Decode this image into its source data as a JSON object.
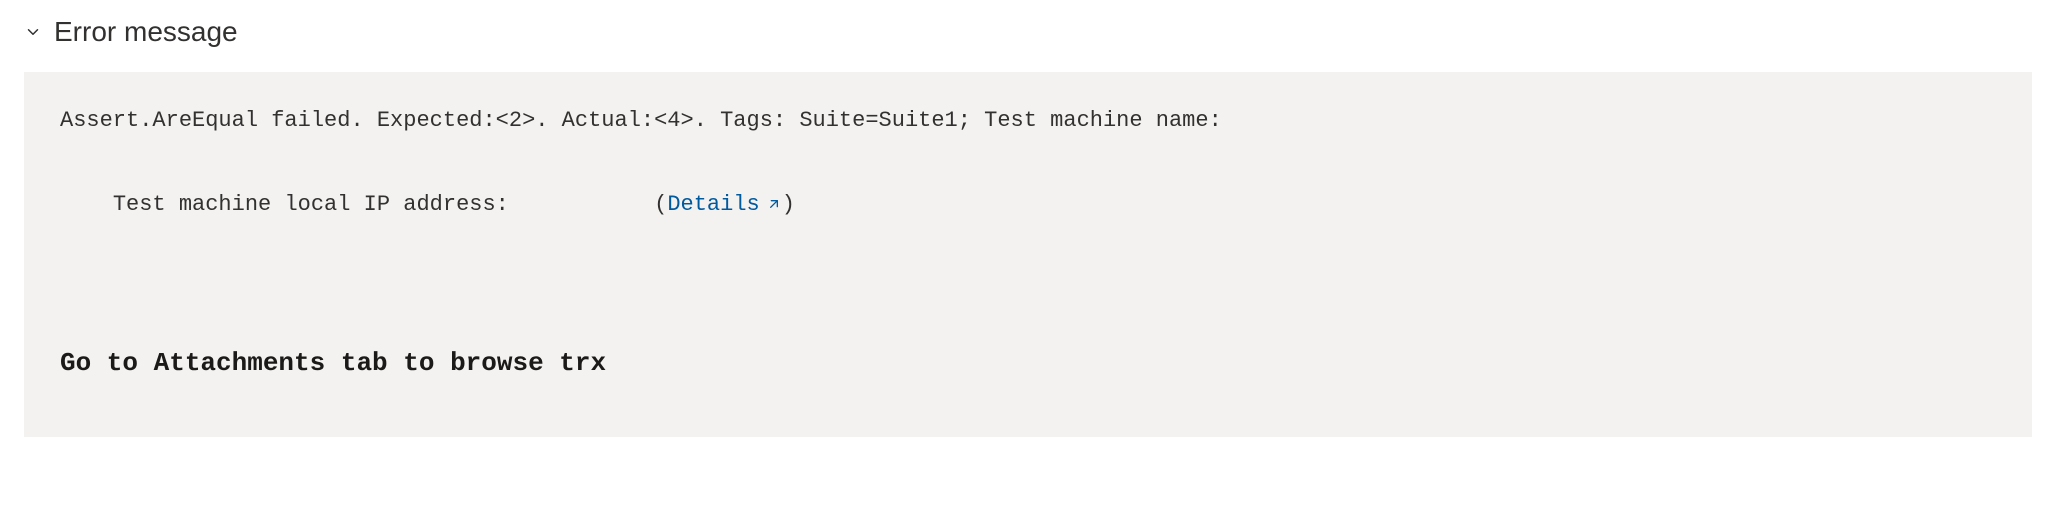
{
  "section": {
    "title": "Error message"
  },
  "error": {
    "line1": "Assert.AreEqual failed. Expected:<2>. Actual:<4>. Tags: Suite=Suite1; Test machine name:",
    "line2_prefix": "Test machine local IP address:           ",
    "details_open": "(",
    "details_label": "Details",
    "details_close": ")"
  },
  "hint": {
    "text": "Go to Attachments tab to browse trx"
  }
}
